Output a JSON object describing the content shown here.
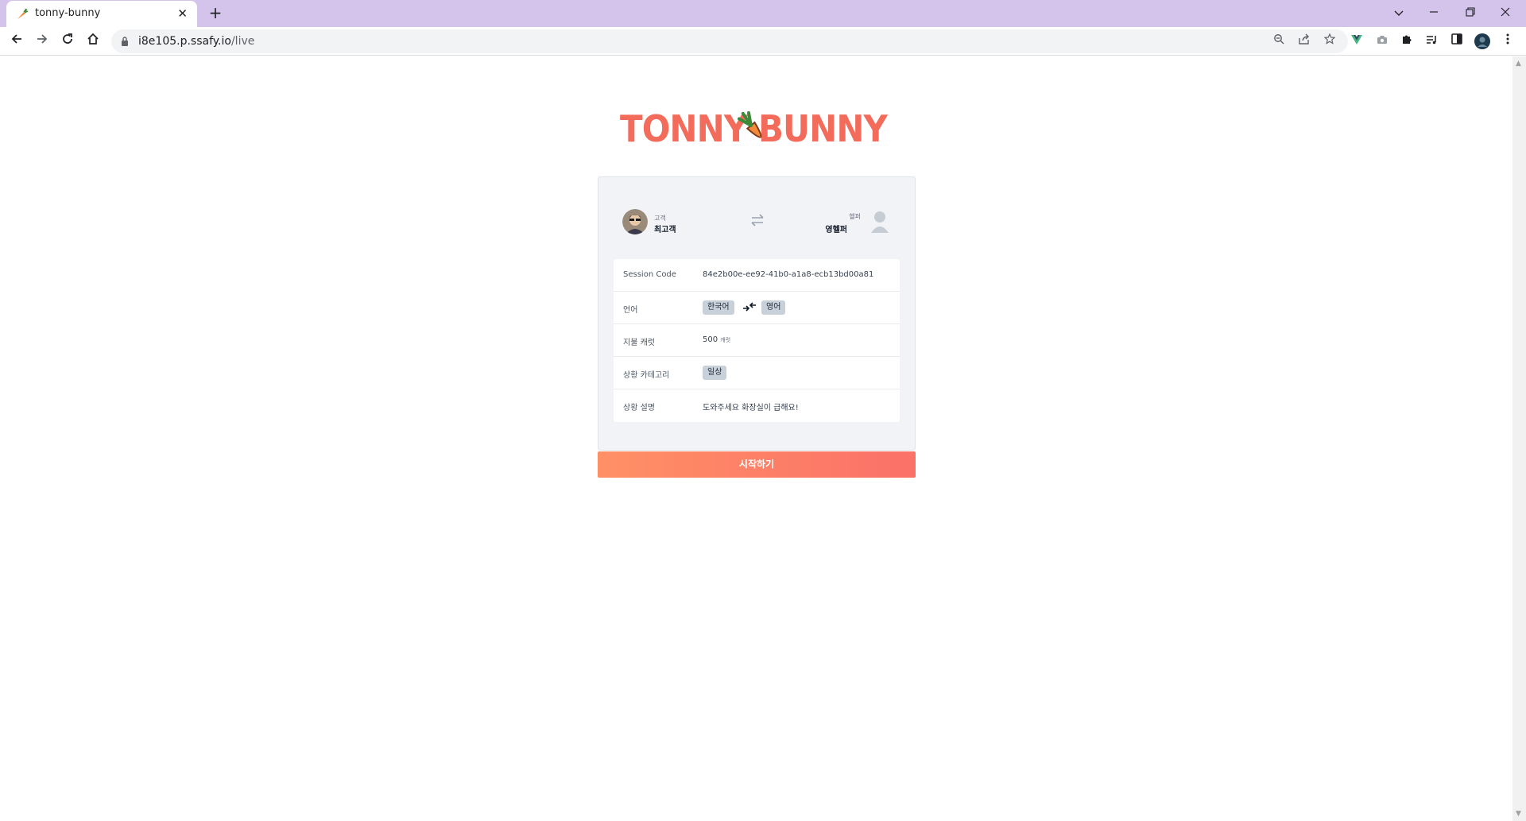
{
  "browser": {
    "tab_title": "tonny-bunny",
    "new_tab": "+",
    "close_tab": "✕",
    "url_host": "i8e105.p.ssafy.io",
    "url_path": "/live",
    "profile_color": "#1f3a4d",
    "tab_strip_color": "#d4c4ec"
  },
  "page": {
    "logo_text": "TONNYBUNNY",
    "logo_color": "#f36b5a",
    "client": {
      "role": "고객",
      "name": "최고객"
    },
    "helper": {
      "role": "헬퍼",
      "name": "영헬퍼"
    },
    "info": {
      "session_label": "Session Code",
      "session_value": "84e2b00e-ee92-41b0-a1a8-ecb13bd00a81",
      "lang_label": "언어",
      "lang_from": "한국어",
      "lang_to": "영어",
      "carrot_label": "지불 캐럿",
      "carrot_value": "500",
      "carrot_unit": "캐럿",
      "category_label": "상황 카테고리",
      "category_value": "일상",
      "desc_label": "상황 설명",
      "desc_value": "도와주세요 화장실이 급해요!"
    },
    "start_button": "시작하기",
    "accent_colors": {
      "button_start": "#ff9066",
      "button_end": "#fb7168"
    }
  }
}
